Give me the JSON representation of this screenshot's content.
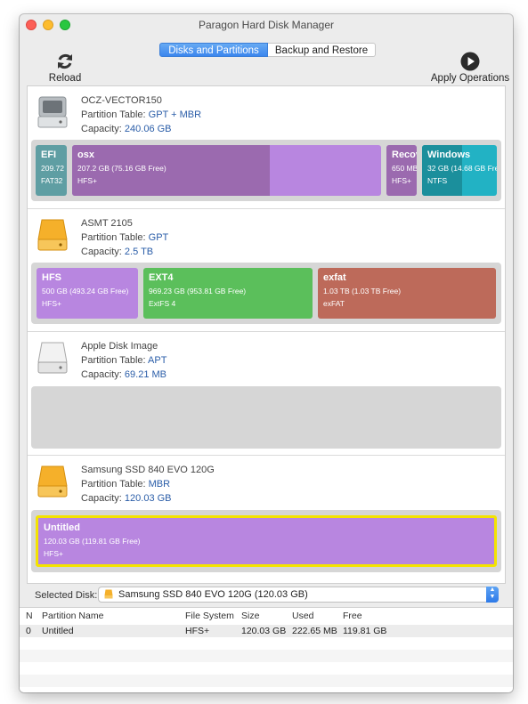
{
  "window": {
    "title": "Paragon Hard Disk Manager"
  },
  "tabs": [
    {
      "label": "Disks and Partitions",
      "selected": true
    },
    {
      "label": "Backup and Restore",
      "selected": false
    }
  ],
  "toolbar": {
    "reload_label": "Reload",
    "apply_label": "Apply Operations"
  },
  "disks": [
    {
      "name": "OCZ-VECTOR150",
      "partition_table_label": "Partition Table:",
      "partition_table": "GPT + MBR",
      "capacity_label": "Capacity:",
      "capacity": "240.06 GB",
      "icon": "hard-drive-gray-icon",
      "partitions": [
        {
          "name": "EFI",
          "size": "209.72",
          "fs": "FAT32",
          "color": "#5f9ea3"
        },
        {
          "name": "osx",
          "size": "207.2 GB (75.16 GB Free)",
          "fs": "HFS+",
          "color": "#b886e0",
          "used_color": "#9b6aaf",
          "used_fraction": 0.64
        },
        {
          "name": "Recov",
          "size": "650 MB",
          "fs": "HFS+",
          "color": "#b886e0",
          "used_color": "#9b6aaf",
          "used_fraction": 1.0
        },
        {
          "name": "Windows",
          "size": "32 GB (14.68 GB Fre",
          "fs": "NTFS",
          "color": "#22b2c4",
          "used_color": "#1b8f9c",
          "used_fraction": 0.54
        }
      ]
    },
    {
      "name": "ASMT 2105",
      "partition_table_label": "Partition Table:",
      "partition_table": "GPT",
      "capacity_label": "Capacity:",
      "capacity": "2.5 TB",
      "icon": "hard-drive-orange-icon",
      "partitions": [
        {
          "name": "HFS",
          "size": "500 GB (493.24 GB Free)",
          "fs": "HFS+",
          "color": "#b886e0"
        },
        {
          "name": "EXT4",
          "size": "969.23 GB (953.81 GB Free)",
          "fs": "ExtFS 4",
          "color": "#5bbf5b"
        },
        {
          "name": "exfat",
          "size": "1.03 TB (1.03 TB Free)",
          "fs": "exFAT",
          "color": "#bd6a5a"
        }
      ]
    },
    {
      "name": "Apple Disk Image",
      "partition_table_label": "Partition Table:",
      "partition_table": "APT",
      "capacity_label": "Capacity:",
      "capacity": "69.21 MB",
      "icon": "hard-drive-white-icon",
      "partitions": []
    },
    {
      "name": "Samsung SSD 840 EVO 120G",
      "partition_table_label": "Partition Table:",
      "partition_table": "MBR",
      "capacity_label": "Capacity:",
      "capacity": "120.03 GB",
      "icon": "hard-drive-orange-icon",
      "partitions": [
        {
          "name": "Untitled",
          "size": "120.03 GB (119.81 GB Free)",
          "fs": "HFS+",
          "color": "#b886e0",
          "selected": true,
          "selection_color": "#f4e300"
        }
      ]
    }
  ],
  "selected_disk": {
    "label": "Selected Disk:",
    "value": "Samsung SSD 840 EVO 120G (120.03 GB)"
  },
  "table": {
    "columns": [
      "N",
      "Partition Name",
      "File System",
      "Size",
      "Used",
      "Free"
    ],
    "rows": [
      {
        "n": "0",
        "name": "Untitled",
        "fs": "HFS+",
        "size": "120.03 GB",
        "used": "222.65 MB",
        "free": "119.81 GB"
      }
    ]
  }
}
